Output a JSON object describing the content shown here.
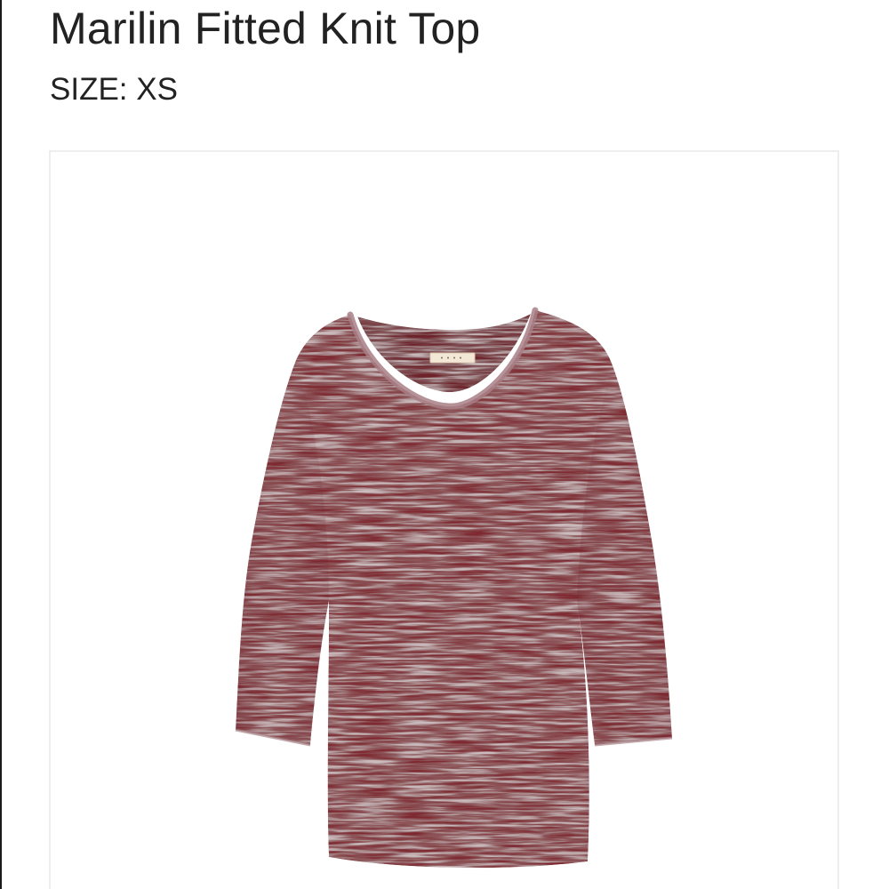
{
  "product": {
    "title": "Marilin Fitted Knit Top",
    "size_text": "SIZE: XS",
    "image": {
      "subject": "burgundy heathered knit top with scoop neck and three-quarter sleeves",
      "colors": {
        "burgundy": "#7f2a33",
        "heather": "#c9b7ba",
        "label": "#f3e7d6"
      }
    }
  }
}
